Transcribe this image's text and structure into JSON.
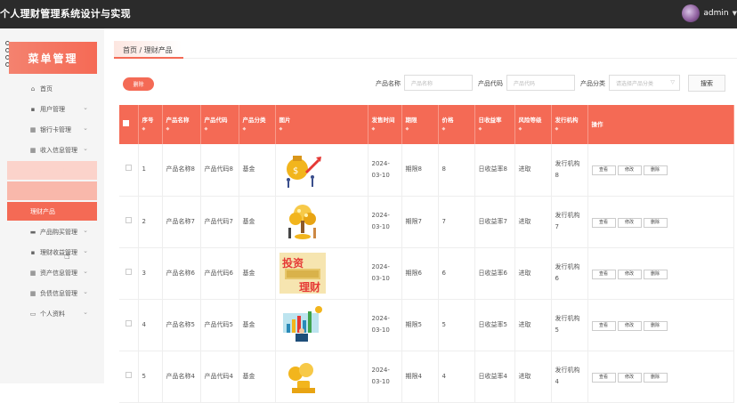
{
  "app": {
    "title": "个人理财管理系统设计与实现",
    "user": "admin"
  },
  "sidebar": {
    "heading": "菜单管理",
    "items": [
      {
        "label": "首页",
        "icon": "home-icon",
        "glyph": "⌂",
        "chevron": false
      },
      {
        "label": "用户管理",
        "icon": "user-icon",
        "glyph": "▪",
        "chevron": true
      },
      {
        "label": "银行卡管理",
        "icon": "grid-icon",
        "glyph": "▦",
        "chevron": true
      },
      {
        "label": "收入信息管理",
        "icon": "grid-icon",
        "glyph": "▦",
        "chevron": true
      }
    ],
    "subitems": [
      {
        "label": "产品类型管理"
      },
      {
        "label": "产品分类管理"
      },
      {
        "label": "理财产品"
      }
    ],
    "items2": [
      {
        "label": "产品购买管理",
        "icon": "tag-icon",
        "glyph": "▬",
        "chevron": true
      },
      {
        "label": "理财收益管理",
        "icon": "doc-icon",
        "glyph": "▪",
        "chevron": true
      },
      {
        "label": "资产信息管理",
        "icon": "grid-icon",
        "glyph": "▦",
        "chevron": true
      },
      {
        "label": "负债信息管理",
        "icon": "grid-icon",
        "glyph": "▦",
        "chevron": true
      },
      {
        "label": "个人资料",
        "icon": "profile-icon",
        "glyph": "▭",
        "chevron": true
      }
    ]
  },
  "breadcrumb": "首页 / 理财产品",
  "toolbar": {
    "delete_label": "删除",
    "name_label": "产品名称",
    "name_placeholder": "产品名称",
    "code_label": "产品代码",
    "code_placeholder": "产品代码",
    "category_label": "产品分类",
    "category_placeholder": "请选择产品分类",
    "search_label": "搜索"
  },
  "table": {
    "headers": [
      "",
      "序号",
      "产品名称",
      "产品代码",
      "产品分类",
      "图片",
      "发售时间",
      "期限",
      "价格",
      "日收益率",
      "风险等级",
      "发行机构",
      "操作"
    ],
    "sortable": [
      false,
      true,
      true,
      true,
      true,
      true,
      true,
      true,
      true,
      true,
      true,
      true,
      false
    ],
    "action_labels": [
      "查看",
      "修改",
      "删除"
    ],
    "rows": [
      {
        "no": "1",
        "name": "产品名称8",
        "code": "产品代码8",
        "category": "基金",
        "image": "money-bag",
        "date": "2024-03-10",
        "term": "期限8",
        "price": "8",
        "yield": "日收益率8",
        "risk": "进取",
        "org": "发行机构8"
      },
      {
        "no": "2",
        "name": "产品名称7",
        "code": "产品代码7",
        "category": "基金",
        "image": "money-tree",
        "date": "2024-03-10",
        "term": "期限7",
        "price": "7",
        "yield": "日收益率7",
        "risk": "进取",
        "org": "发行机构7"
      },
      {
        "no": "3",
        "name": "产品名称6",
        "code": "产品代码6",
        "category": "基金",
        "image": "invest-text",
        "image_text": [
          "投资",
          "理财"
        ],
        "date": "2024-03-10",
        "term": "期限6",
        "price": "6",
        "yield": "日收益率6",
        "risk": "进取",
        "org": "发行机构6"
      },
      {
        "no": "4",
        "name": "产品名称5",
        "code": "产品代码5",
        "category": "基金",
        "image": "bar-chart",
        "date": "2024-03-10",
        "term": "期限5",
        "price": "5",
        "yield": "日收益率5",
        "risk": "进取",
        "org": "发行机构5"
      },
      {
        "no": "5",
        "name": "产品名称4",
        "code": "产品代码4",
        "category": "基金",
        "image": "coins",
        "date": "2024-03-10",
        "term": "期限4",
        "price": "4",
        "yield": "日收益率4",
        "risk": "进取",
        "org": "发行机构4"
      }
    ]
  },
  "colors": {
    "accent": "#f46a55",
    "topbar": "#2b2b2b",
    "sidebar": "#f5f5f5"
  }
}
